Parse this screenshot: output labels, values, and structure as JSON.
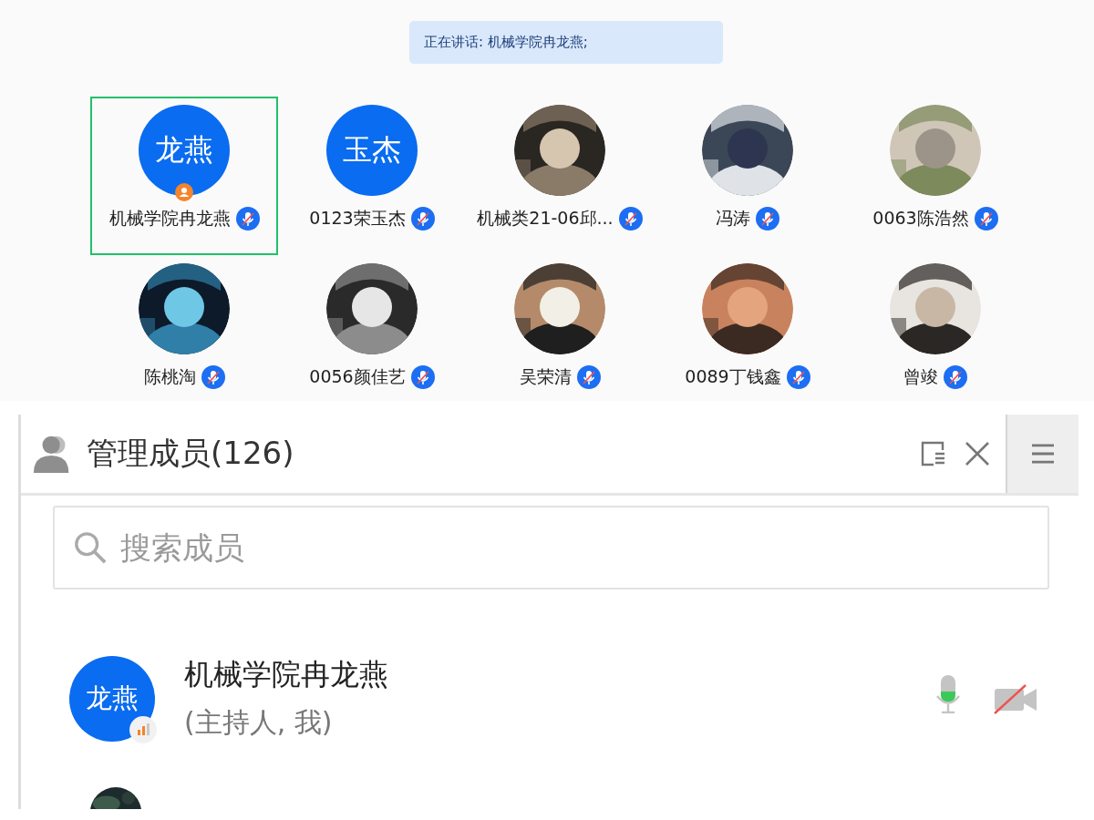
{
  "speaking_banner": {
    "text": "正在讲话: 机械学院冉龙燕;"
  },
  "video_grid": {
    "participants": [
      {
        "name": "机械学院冉龙燕",
        "avatar": {
          "kind": "initials",
          "text": "龙燕"
        },
        "host": true,
        "muted": true,
        "selected": true
      },
      {
        "name": "0123荣玉杰",
        "avatar": {
          "kind": "initials",
          "text": "玉杰"
        },
        "host": false,
        "muted": true,
        "selected": false
      },
      {
        "name": "机械类21-06邱...",
        "host": false,
        "muted": true,
        "selected": false
      },
      {
        "name": "冯涛",
        "host": false,
        "muted": true,
        "selected": false
      },
      {
        "name": "0063陈浩然",
        "host": false,
        "muted": true,
        "selected": false
      },
      {
        "name": "陈桃淘",
        "host": false,
        "muted": true,
        "selected": false
      },
      {
        "name": "0056颜佳艺",
        "host": false,
        "muted": true,
        "selected": false
      },
      {
        "name": "吴荣清",
        "host": false,
        "muted": true,
        "selected": false
      },
      {
        "name": "0089丁钱鑫",
        "host": false,
        "muted": true,
        "selected": false
      },
      {
        "name": "曾竣",
        "host": false,
        "muted": true,
        "selected": false
      }
    ]
  },
  "members_panel": {
    "title": "管理成员(126)",
    "search": {
      "placeholder": "搜索成员"
    },
    "members": [
      {
        "name": "机械学院冉龙燕",
        "role": "(主持人, 我)",
        "avatar": {
          "kind": "initials",
          "text": "龙燕"
        },
        "speaking": true,
        "mic": {
          "level": 0.4
        },
        "camera_on": false
      }
    ]
  }
}
